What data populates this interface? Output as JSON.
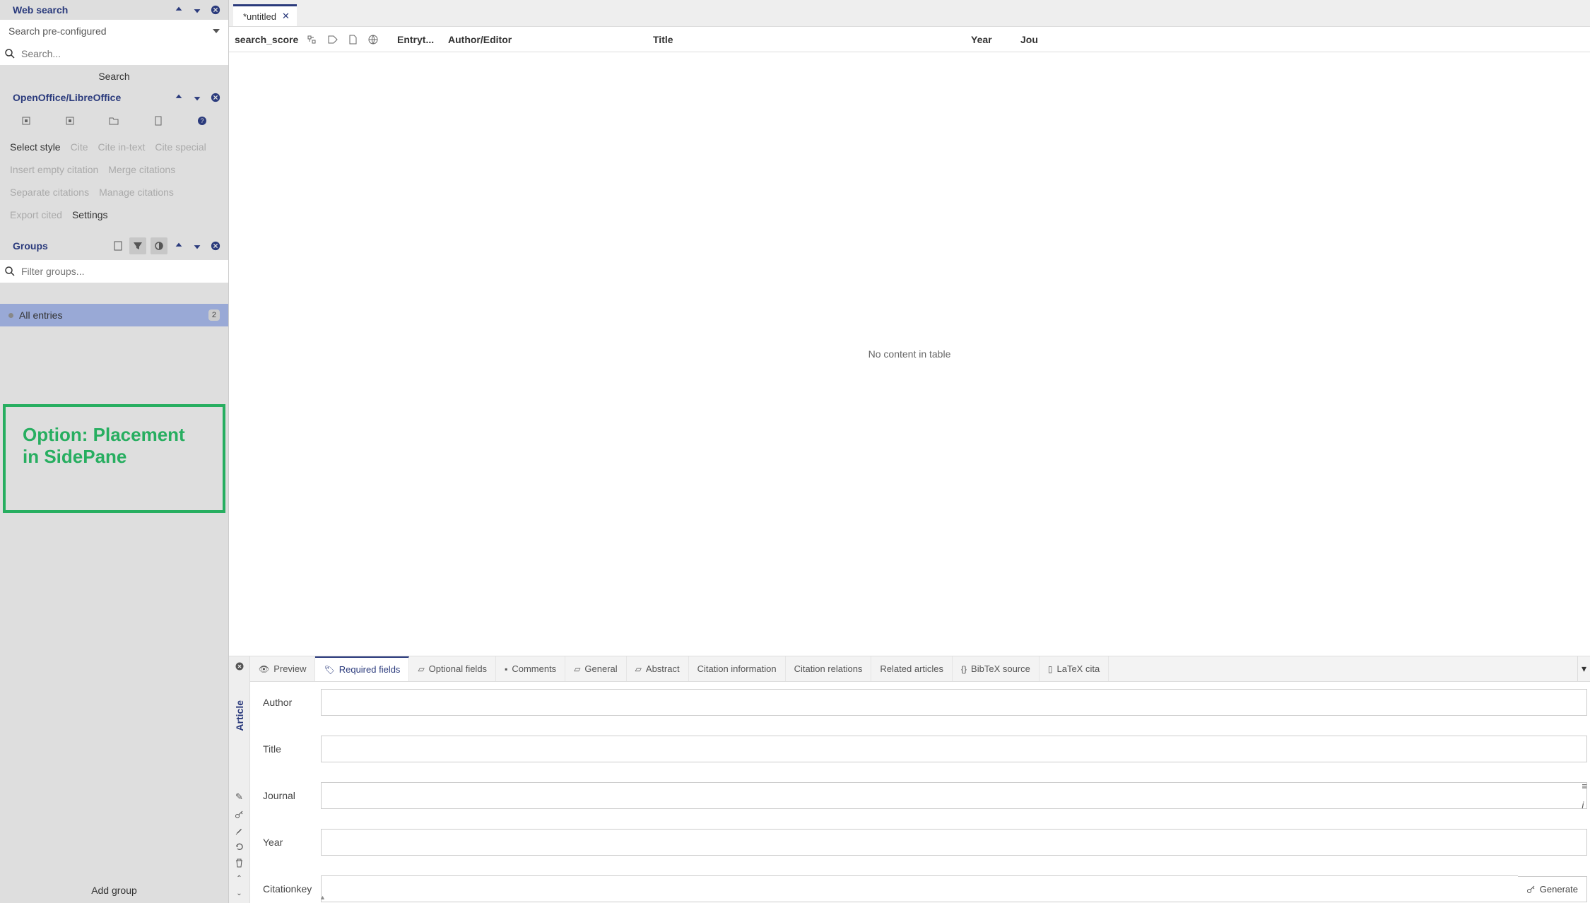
{
  "sidebar": {
    "websearch": {
      "title": "Web search",
      "dropdown": "Search pre-configured",
      "search_placeholder": "Search...",
      "search_btn": "Search"
    },
    "office": {
      "title": "OpenOffice/LibreOffice",
      "links": {
        "select_style": "Select style",
        "cite": "Cite",
        "cite_intext": "Cite in-text",
        "cite_special": "Cite special",
        "insert_empty": "Insert empty citation",
        "merge": "Merge citations",
        "separate": "Separate citations",
        "manage": "Manage citations",
        "export_cited": "Export cited",
        "settings": "Settings"
      }
    },
    "groups": {
      "title": "Groups",
      "filter_placeholder": "Filter groups...",
      "all_entries": "All entries",
      "count": "2",
      "add_group": "Add group"
    },
    "annotation": "Option: Placement in SidePane"
  },
  "main": {
    "tab": "*untitled",
    "columns": {
      "score": "search_score",
      "entrytype": "Entryt...",
      "author": "Author/Editor",
      "title": "Title",
      "year": "Year",
      "journal": "Jou"
    },
    "empty": "No content in table"
  },
  "editor": {
    "rail_label": "Article",
    "tabs": {
      "preview": "Preview",
      "required": "Required fields",
      "optional": "Optional fields",
      "comments": "Comments",
      "general": "General",
      "abstract": "Abstract",
      "citation_info": "Citation information",
      "citation_rel": "Citation relations",
      "related": "Related articles",
      "bibtex": "BibTeX source",
      "latex": "LaTeX cita"
    },
    "fields": {
      "author": "Author",
      "title": "Title",
      "journal": "Journal",
      "year": "Year",
      "citationkey": "Citationkey"
    },
    "generate": "Generate"
  }
}
